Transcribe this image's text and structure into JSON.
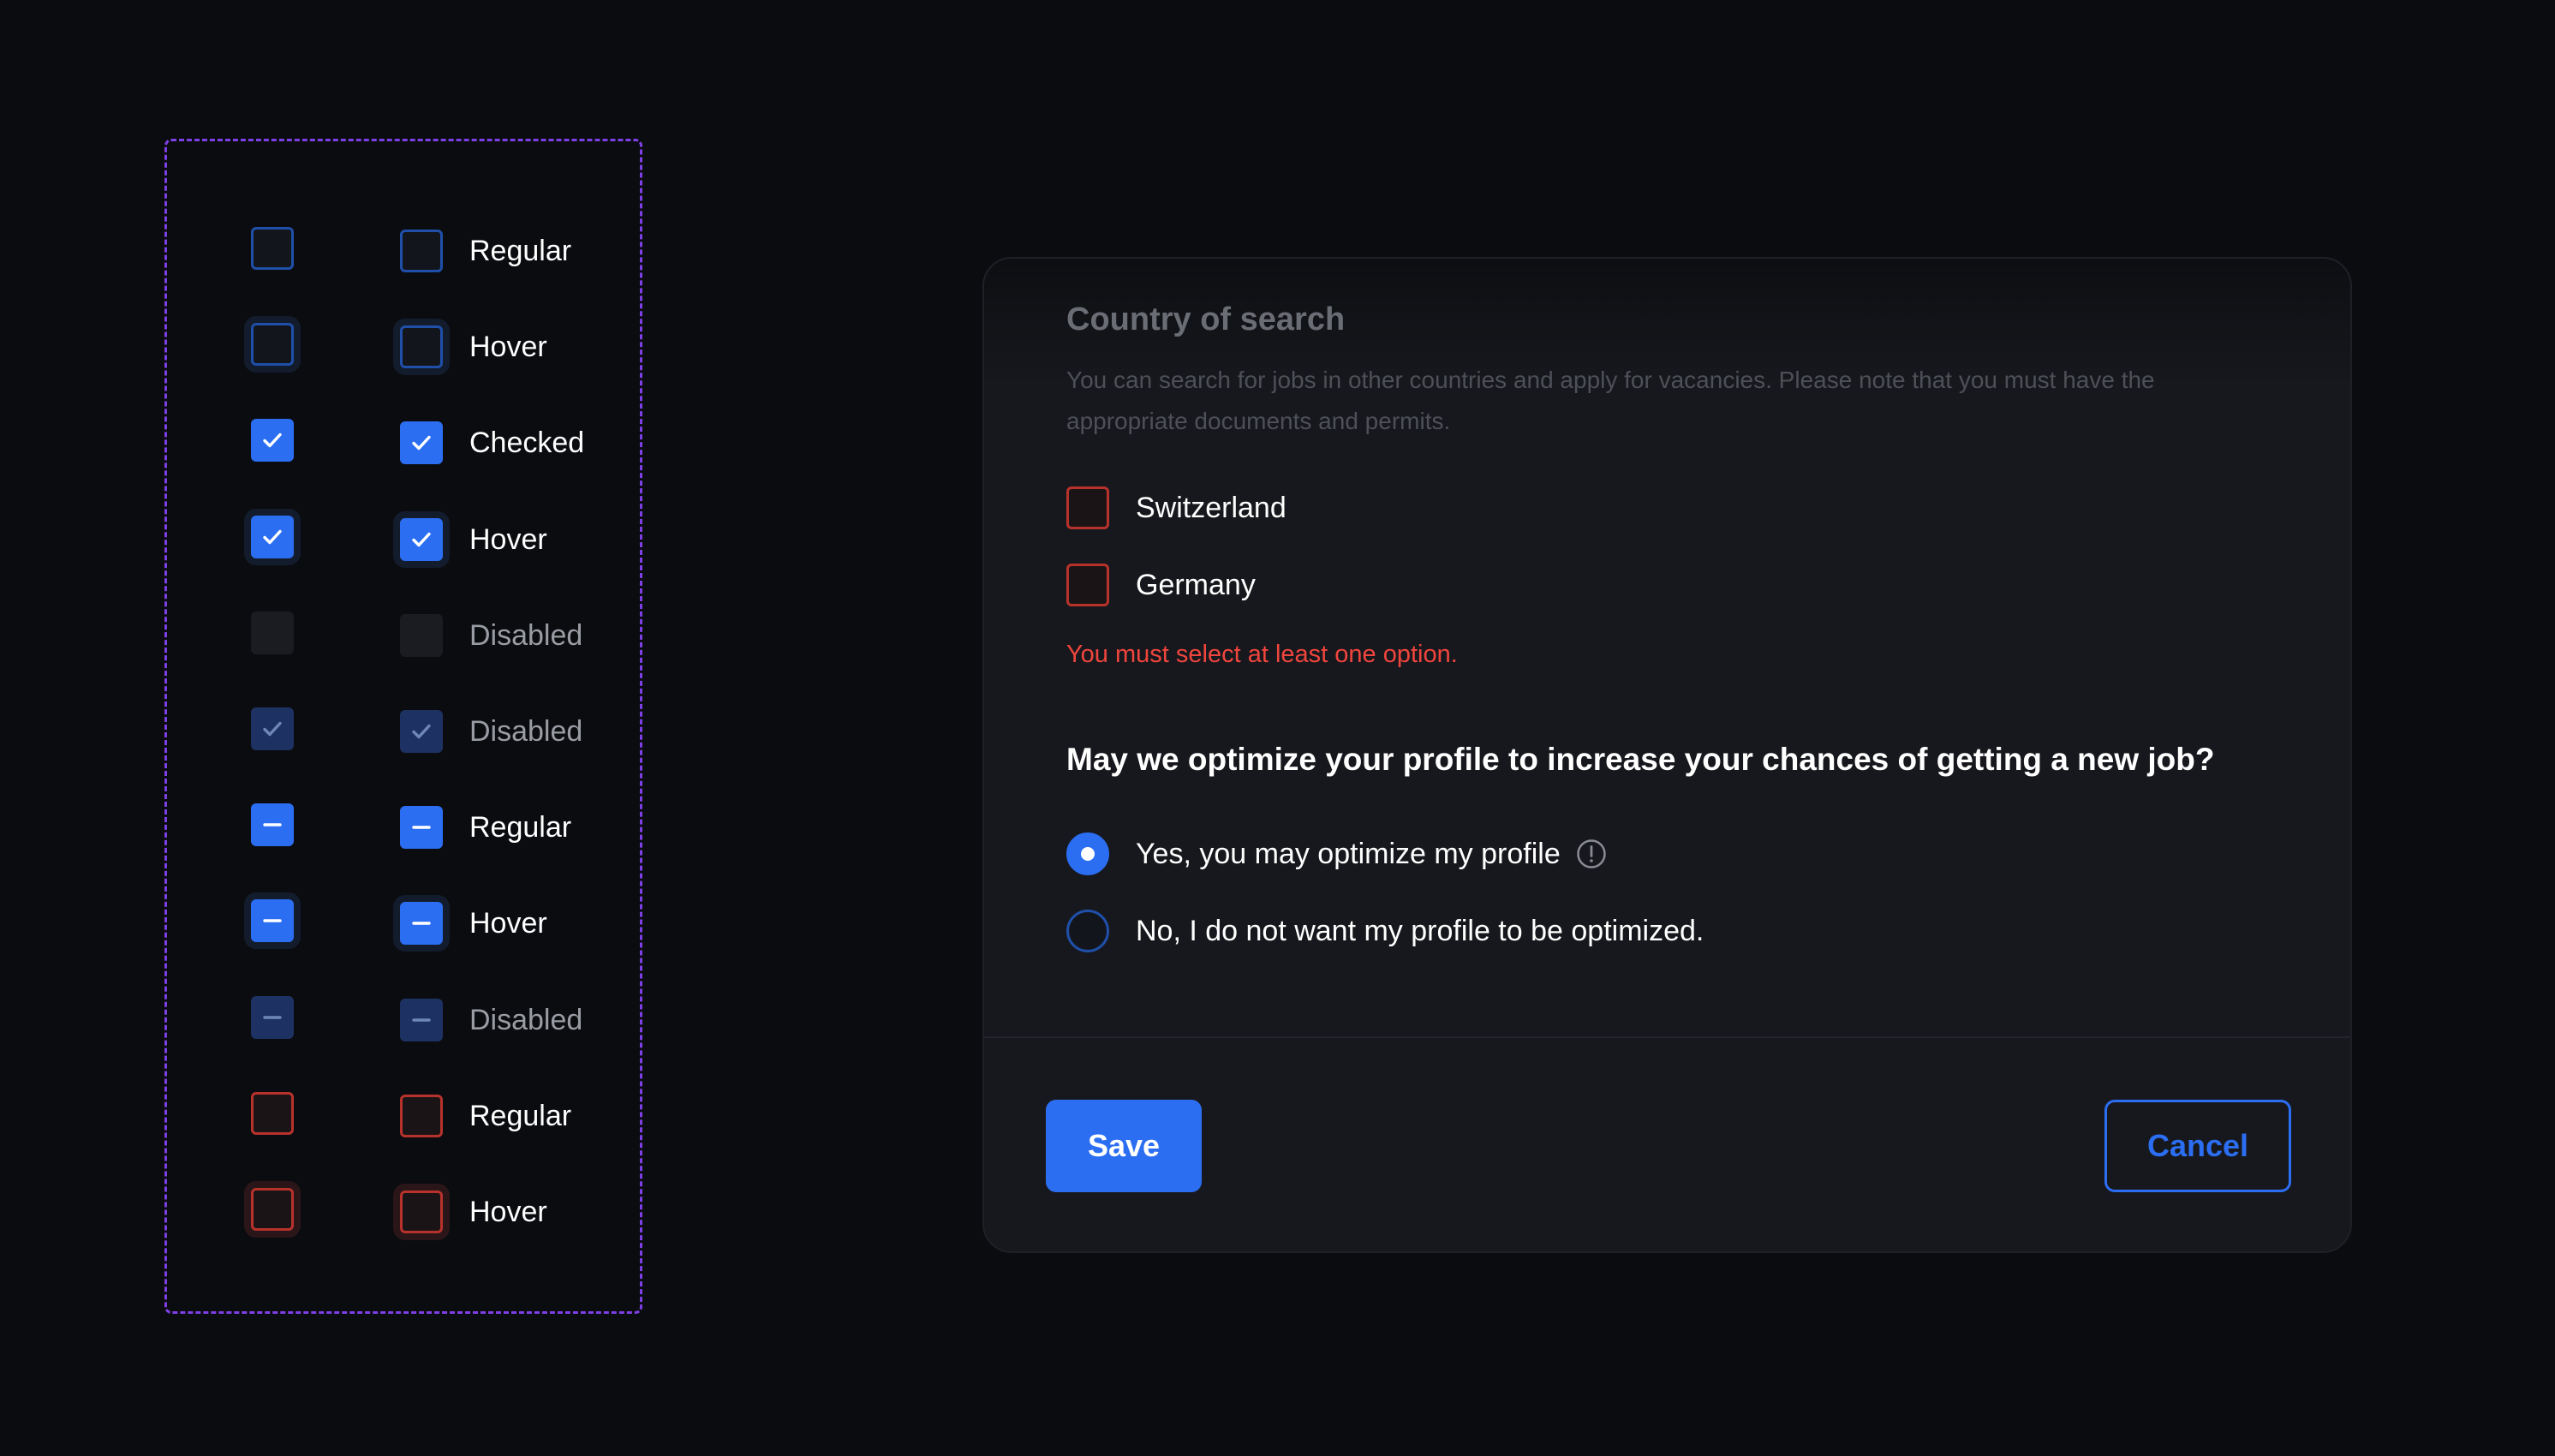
{
  "colors": {
    "background": "#0b0c10",
    "accent": "#2b6ef2",
    "error": "#f0453d",
    "sheet_border": "#7e3fe6",
    "card": "#17181d"
  },
  "checkbox_sheet": {
    "rows": [
      {
        "state": "regular",
        "label": "Regular"
      },
      {
        "state": "hover",
        "label": "Hover"
      },
      {
        "state": "checked",
        "label": "Checked"
      },
      {
        "state": "checked-hover",
        "label": "Hover"
      },
      {
        "state": "disabled",
        "label": "Disabled"
      },
      {
        "state": "disabled-checked",
        "label": "Disabled"
      },
      {
        "state": "indeterminate",
        "label": "Regular"
      },
      {
        "state": "indeterminate-hover",
        "label": "Hover"
      },
      {
        "state": "indeterminate-disabled",
        "label": "Disabled"
      },
      {
        "state": "error",
        "label": "Regular"
      },
      {
        "state": "error-hover",
        "label": "Hover"
      }
    ]
  },
  "form": {
    "title": "Country of search",
    "description": "You can search for jobs in other countries and apply for vacancies. Please note that you must have the appropriate documents and permits.",
    "countries": [
      {
        "label": "Switzerland",
        "checked": false,
        "state": "error"
      },
      {
        "label": "Germany",
        "checked": false,
        "state": "error"
      }
    ],
    "error_message": "You must select at least one option.",
    "question": "May we optimize your profile to increase your chances of getting a new job?",
    "radio_options": [
      {
        "label": "Yes, you may optimize my profile",
        "selected": true,
        "icon": "info-icon"
      },
      {
        "label": "No, I do not want my profile to be optimized.",
        "selected": false
      }
    ],
    "save_label": "Save",
    "cancel_label": "Cancel"
  }
}
